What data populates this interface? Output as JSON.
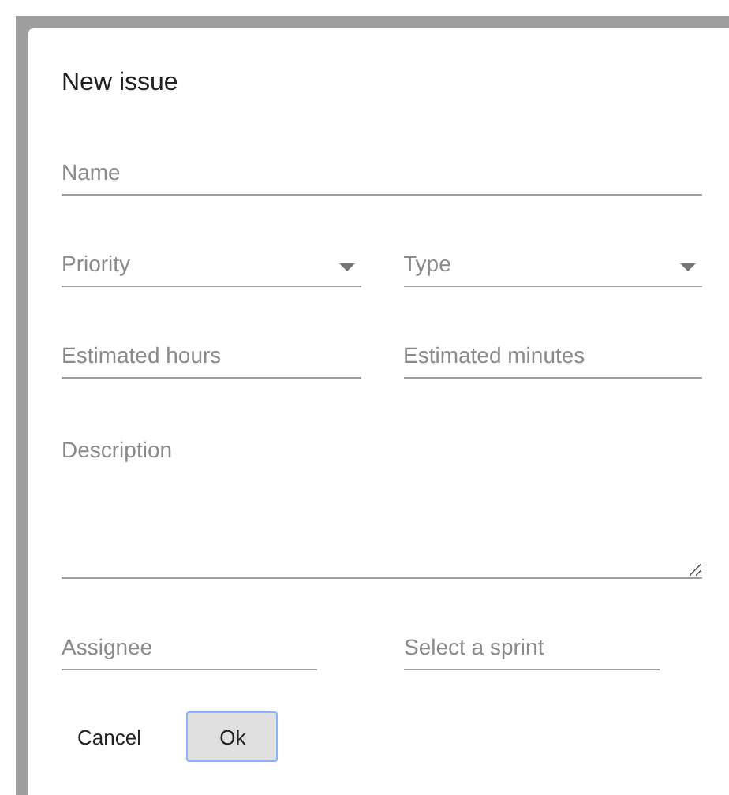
{
  "dialog": {
    "title": "New issue",
    "rows": [
      [
        {
          "kind": "text",
          "placeholder": "Name"
        }
      ],
      [
        {
          "kind": "select",
          "placeholder": "Priority"
        },
        {
          "kind": "select",
          "placeholder": "Type"
        }
      ],
      [
        {
          "kind": "text",
          "placeholder": "Estimated hours"
        },
        {
          "kind": "text",
          "placeholder": "Estimated minutes"
        }
      ],
      [
        {
          "kind": "textarea",
          "placeholder": "Description"
        }
      ],
      [
        {
          "kind": "text",
          "placeholder": "Assignee",
          "narrow": true
        },
        {
          "kind": "text",
          "placeholder": "Select a sprint",
          "narrow": true
        }
      ]
    ],
    "buttons": [
      {
        "label": "Cancel",
        "kind": "flat"
      },
      {
        "label": "Ok",
        "kind": "raised"
      }
    ]
  }
}
